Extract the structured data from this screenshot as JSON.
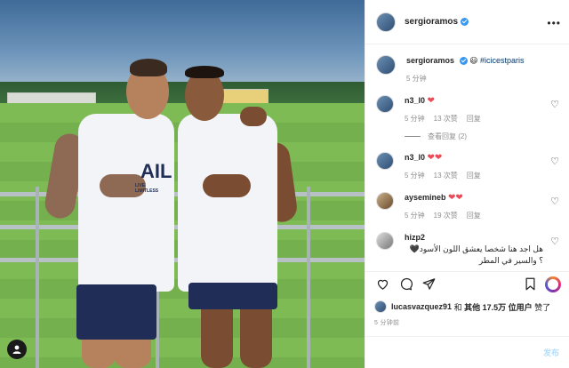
{
  "post": {
    "author": "sergioramos",
    "caption_author": "sergioramos",
    "caption_emoji": "😃",
    "caption_hashtag": "#icicestparis",
    "caption_time": "5 分钟"
  },
  "photo": {
    "user_tag_icon": "person-icon",
    "shirt_text": "AIL",
    "shirt_sub": "LIVE LIMITLESS"
  },
  "comments": [
    {
      "user": "n3_l0",
      "text": "❤",
      "time": "5 分钟",
      "likes": "13 次赞",
      "reply": "回复"
    },
    {
      "user": "n3_l0",
      "text": "❤❤",
      "time": "5 分钟",
      "likes": "13 次赞",
      "reply": "回复"
    },
    {
      "user": "aysemineb",
      "text": "❤❤",
      "time": "5 分钟",
      "likes": "19 次赞",
      "reply": "回复"
    },
    {
      "user": "hizp2",
      "text": "هل اجد هنا شخصا يعشق اللون الأسود🖤 ؟ والسير في المطر"
    }
  ],
  "view_replies": "查看回复 (2)",
  "likes": {
    "liker": "lucasvazquez91",
    "and": "和",
    "others_label": "其他 17.5万 位用户",
    "suffix": "赞了"
  },
  "time_ago": "5 分钟前",
  "add_comment": {
    "placeholder": "",
    "post_label": "发布"
  },
  "colors": {
    "link_blue": "#00376b",
    "verified": "#3897f0",
    "heart_red": "#ed4956",
    "post_disabled": "#b2dffc"
  }
}
